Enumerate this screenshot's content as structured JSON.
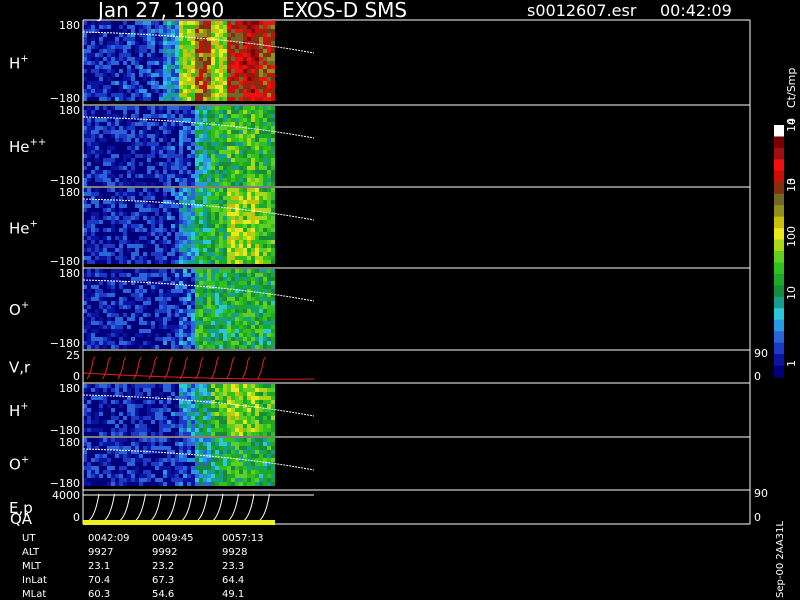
{
  "header": {
    "date": "Jan 27, 1990",
    "instrument": "EXOS-D SMS",
    "file": "s0012607.esr",
    "time": "00:42:09"
  },
  "colorbar": {
    "unit_label": "Ct/Smp",
    "tick_labels": [
      "1",
      "10",
      "100",
      "10",
      "3",
      "10",
      "4"
    ],
    "colors": [
      "#00007a",
      "#0a14a0",
      "#1c3ac6",
      "#2a66d8",
      "#2a98e4",
      "#2cc8d8",
      "#16a08c",
      "#168c3c",
      "#1ea82a",
      "#30c020",
      "#60d020",
      "#a8d818",
      "#e8e81c",
      "#c8c00c",
      "#909018",
      "#706828",
      "#803010",
      "#c81008",
      "#f01010",
      "#a01010",
      "#780000",
      "#ffffff"
    ]
  },
  "chart_data": {
    "type": "heatmap",
    "time_range": [
      "0042:09",
      "0057:13"
    ],
    "panels": [
      {
        "species": "H",
        "charge": "+",
        "ytop": "180",
        "ybot": "−180",
        "kind": "heat",
        "intensity": [
          0.05,
          0.05,
          0.06,
          0.07,
          0.1,
          0.2,
          0.55,
          0.75,
          0.55,
          0.85,
          0.9,
          0.8,
          0.0
        ]
      },
      {
        "species": "He",
        "charge": "++",
        "ytop": "180",
        "ybot": "−180",
        "kind": "heat",
        "intensity": [
          0.05,
          0.05,
          0.05,
          0.05,
          0.05,
          0.06,
          0.1,
          0.3,
          0.4,
          0.42,
          0.45,
          0.4,
          0.0
        ]
      },
      {
        "species": "He",
        "charge": "+",
        "ytop": "180",
        "ybot": "−180",
        "kind": "heat",
        "intensity": [
          0.05,
          0.05,
          0.05,
          0.05,
          0.05,
          0.06,
          0.2,
          0.35,
          0.4,
          0.55,
          0.52,
          0.45,
          0.0
        ]
      },
      {
        "species": "O",
        "charge": "+",
        "ytop": "180",
        "ybot": "−180",
        "kind": "heat",
        "intensity": [
          0.05,
          0.05,
          0.05,
          0.05,
          0.05,
          0.06,
          0.12,
          0.4,
          0.35,
          0.38,
          0.4,
          0.38,
          0.0
        ]
      },
      {
        "species": "V,r",
        "charge": "",
        "ytop": "25",
        "ybot": "0",
        "right_top": "90",
        "right_bot": "0",
        "kind": "vr"
      },
      {
        "species": "H",
        "charge": "+",
        "ytop": "180",
        "ybot": "−180",
        "kind": "heat",
        "intensity": [
          0.05,
          0.05,
          0.05,
          0.05,
          0.05,
          0.06,
          0.2,
          0.3,
          0.45,
          0.55,
          0.5,
          0.45,
          0.0
        ]
      },
      {
        "species": "O",
        "charge": "+",
        "ytop": "180",
        "ybot": "−180",
        "kind": "heat",
        "intensity": [
          0.05,
          0.05,
          0.05,
          0.05,
          0.05,
          0.06,
          0.1,
          0.25,
          0.35,
          0.4,
          0.4,
          0.38,
          0.0
        ]
      },
      {
        "species": "E,p",
        "charge": "",
        "ytop": "4000",
        "ybot": "0",
        "right_top": "90",
        "right_bot": "0",
        "kind": "ep"
      }
    ],
    "qa_label": "QA"
  },
  "footer": {
    "rows": [
      {
        "label": "UT",
        "values": [
          "0042:09",
          "0049:45",
          "0057:13"
        ]
      },
      {
        "label": "ALT",
        "values": [
          "9927",
          "9992",
          "9928"
        ]
      },
      {
        "label": "MLT",
        "values": [
          "23.1",
          "23.2",
          "23.3"
        ]
      },
      {
        "label": "InLat",
        "values": [
          "70.4",
          "67.3",
          "64.4"
        ]
      },
      {
        "label": "MLat",
        "values": [
          "60.3",
          "54.6",
          "49.1"
        ]
      }
    ],
    "vertical_note": "Sep-00 2AA31L"
  }
}
